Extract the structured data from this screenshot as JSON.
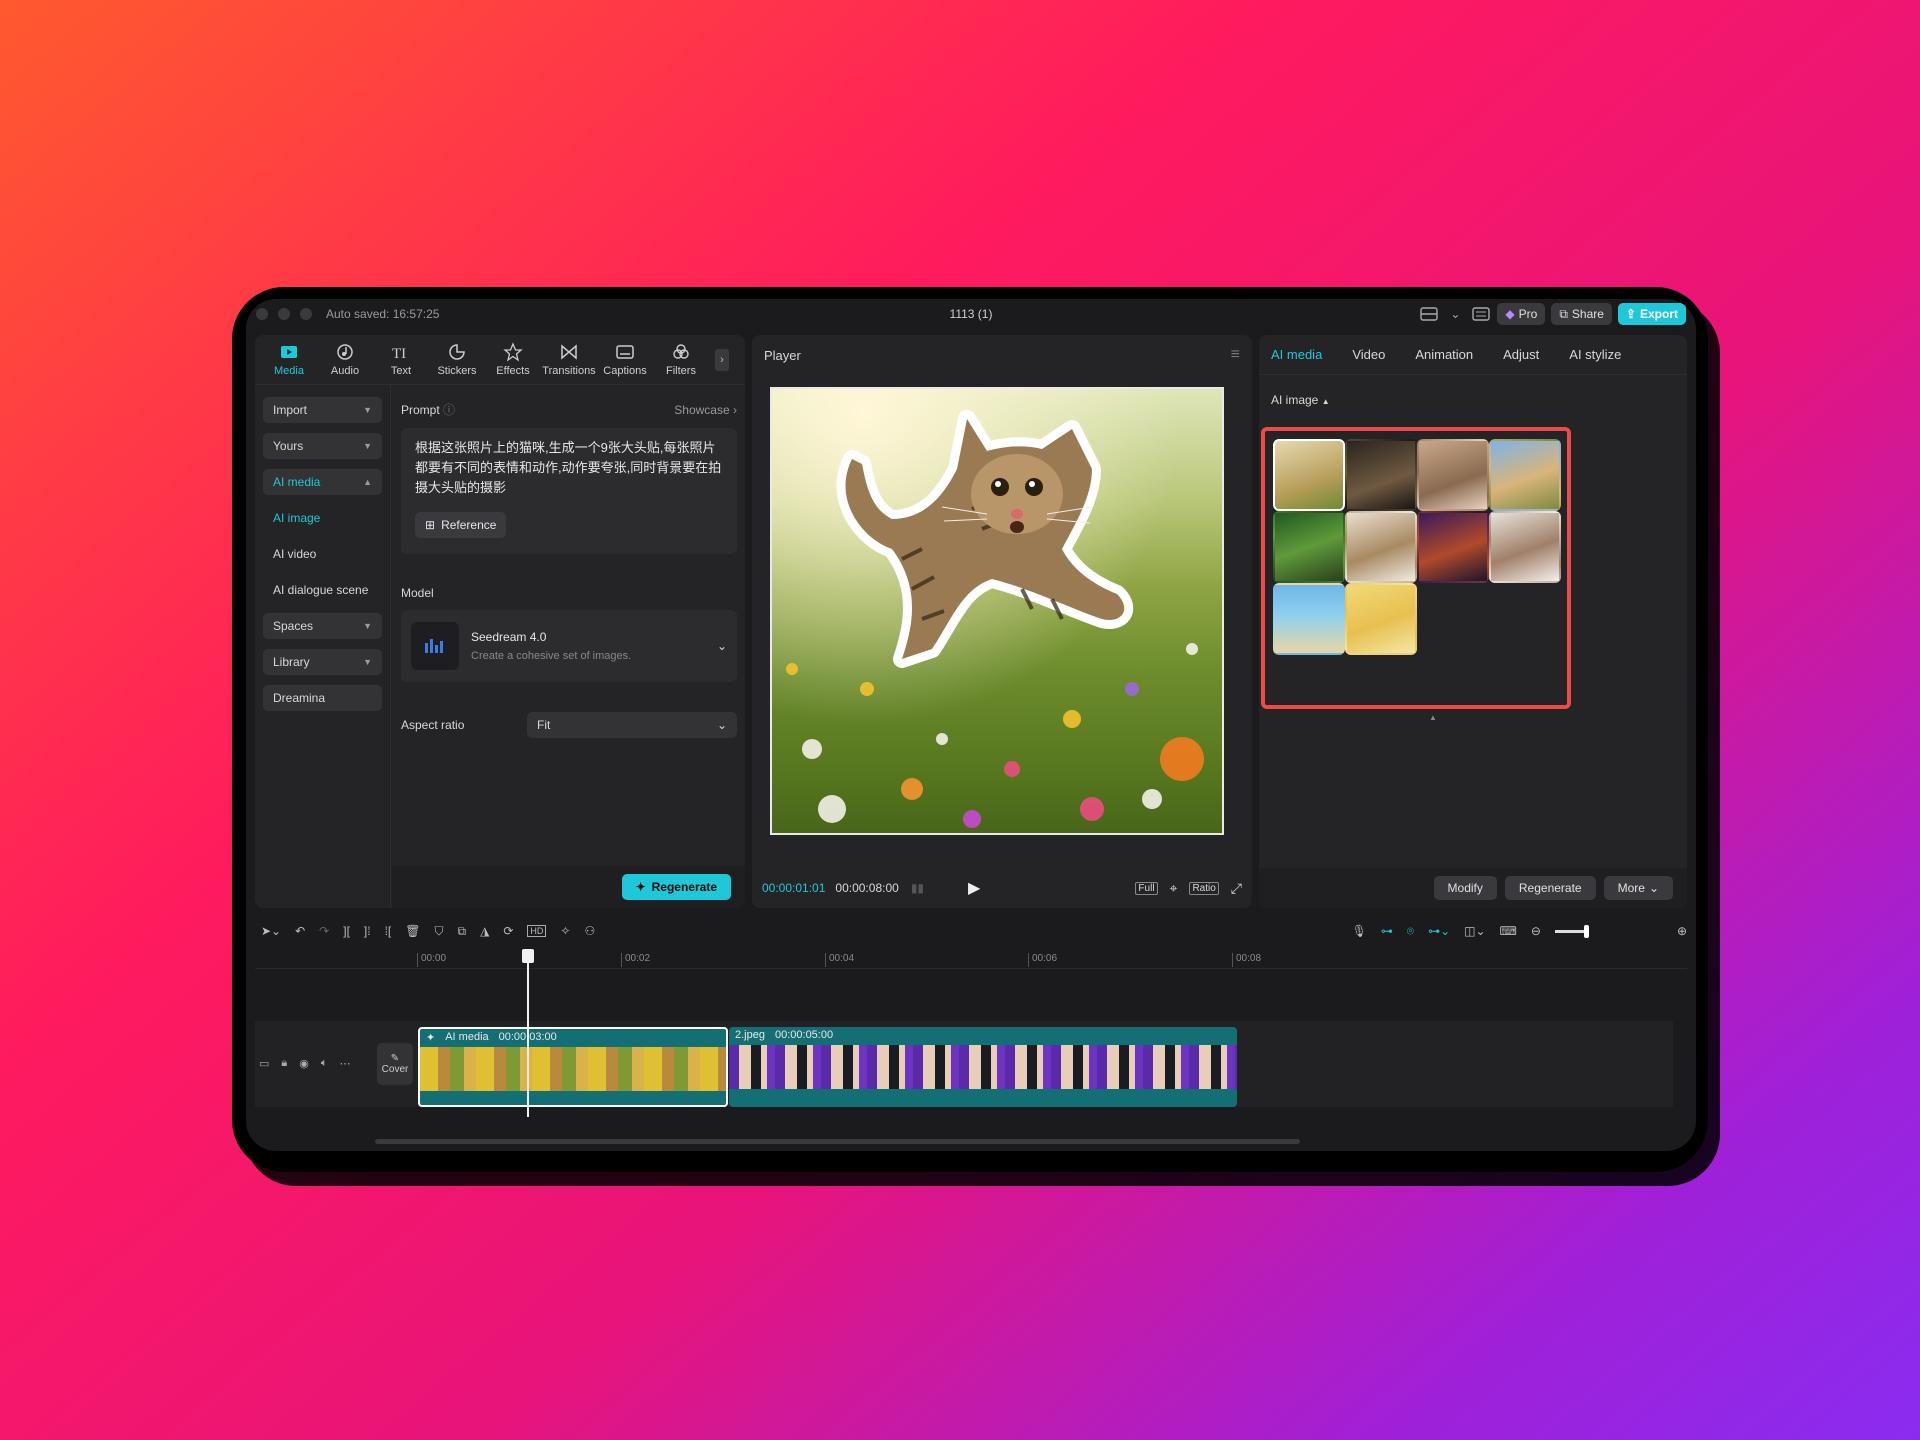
{
  "titlebar": {
    "autosave": "Auto saved: 16:57:25",
    "project_title": "1113 (1)",
    "pro_label": "Pro",
    "share_label": "Share",
    "export_label": "Export"
  },
  "tabs": [
    {
      "label": "Media",
      "icon": "media-icon"
    },
    {
      "label": "Audio",
      "icon": "audio-icon"
    },
    {
      "label": "Text",
      "icon": "text-icon"
    },
    {
      "label": "Stickers",
      "icon": "stickers-icon"
    },
    {
      "label": "Effects",
      "icon": "effects-icon"
    },
    {
      "label": "Transitions",
      "icon": "transitions-icon"
    },
    {
      "label": "Captions",
      "icon": "captions-icon"
    },
    {
      "label": "Filters",
      "icon": "filters-icon"
    }
  ],
  "nav": {
    "import": "Import",
    "yours": "Yours",
    "ai_media": "AI media",
    "ai_image": "AI image",
    "ai_video": "AI video",
    "ai_dialogue": "AI dialogue scene",
    "spaces": "Spaces",
    "library": "Library",
    "dreamina": "Dreamina"
  },
  "form": {
    "prompt_label": "Prompt",
    "showcase": "Showcase",
    "prompt_text": "根据这张照片上的猫咪,生成一个9张大头贴,每张照片都要有不同的表情和动作,动作要夸张,同时背景要在拍摄大头贴的摄影",
    "reference_label": "Reference",
    "model_label": "Model",
    "model_name": "Seedream 4.0",
    "model_desc": "Create a cohesive set of images.",
    "aspect_label": "Aspect ratio",
    "aspect_value": "Fit",
    "regenerate": "Regenerate"
  },
  "player": {
    "title": "Player",
    "current_time": "00:00:01:01",
    "total_time": "00:00:08:00",
    "full": "Full",
    "ratio": "Ratio"
  },
  "right": {
    "tabs": [
      "AI media",
      "Video",
      "Animation",
      "Adjust",
      "AI stylize"
    ],
    "section": "AI image",
    "modify": "Modify",
    "regenerate": "Regenerate",
    "more": "More"
  },
  "timeline": {
    "ticks": [
      "00:00",
      "00:02",
      "00:04",
      "00:06",
      "00:08"
    ],
    "cover": "Cover",
    "clip1_name": "AI media",
    "clip1_dur": "00:00:03:00",
    "clip2_name": "2.jpeg",
    "clip2_dur": "00:00:05:00"
  },
  "colors": {
    "accent": "#1fc8d8",
    "highlight": "#ef4a4a"
  }
}
